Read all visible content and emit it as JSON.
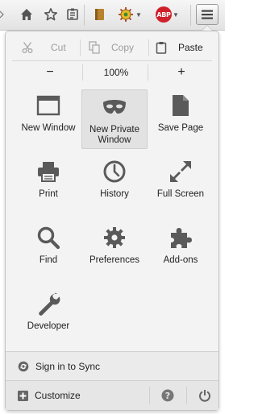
{
  "toolbar": {
    "icons": [
      "home-icon",
      "bookmark-star-icon",
      "reading-list-icon",
      "notebook-icon",
      "extension-icon",
      "abp-icon"
    ],
    "abp_label": "ABP"
  },
  "edit": {
    "cut": "Cut",
    "copy": "Copy",
    "paste": "Paste"
  },
  "zoom": {
    "out": "−",
    "level": "100%",
    "in": "+"
  },
  "items": [
    {
      "label": "New Window",
      "icon": "window-icon"
    },
    {
      "label": "New Private Window",
      "icon": "mask-icon"
    },
    {
      "label": "Save Page",
      "icon": "page-icon"
    },
    {
      "label": "Print",
      "icon": "printer-icon"
    },
    {
      "label": "History",
      "icon": "clock-icon"
    },
    {
      "label": "Full Screen",
      "icon": "fullscreen-arrows-icon"
    },
    {
      "label": "Find",
      "icon": "magnifier-icon"
    },
    {
      "label": "Preferences",
      "icon": "gear-icon"
    },
    {
      "label": "Add-ons",
      "icon": "puzzle-icon"
    },
    {
      "label": "Developer",
      "icon": "wrench-icon"
    }
  ],
  "footer": {
    "sync": "Sign in to Sync",
    "customize": "Customize"
  },
  "colors": {
    "icon": "#5a5a5a",
    "disabled": "#9c9c9c",
    "abp": "#d0202a"
  }
}
